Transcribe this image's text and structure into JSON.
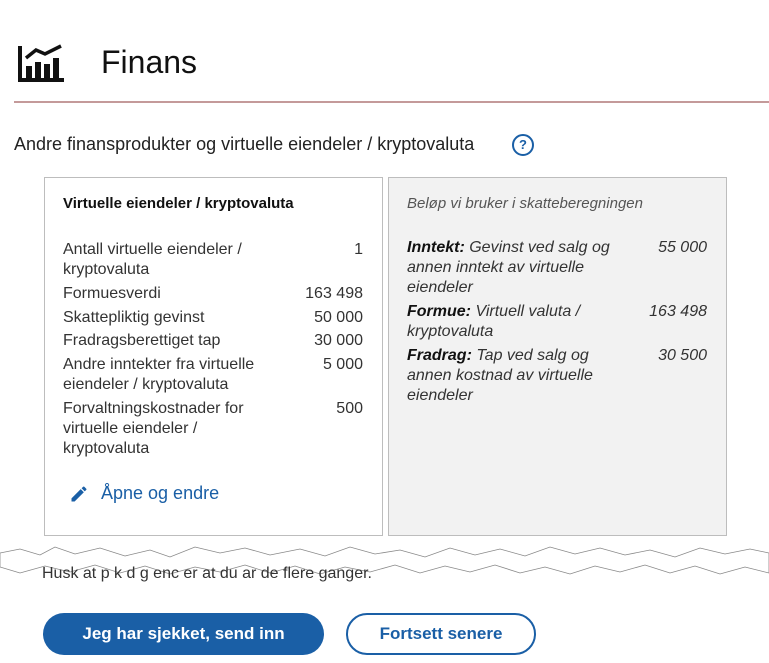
{
  "header": {
    "title": "Finans",
    "icon": "bar-chart-icon"
  },
  "section": {
    "title": "Andre finansprodukter og virtuelle eiendeler / kryptovaluta",
    "help_icon": "question-circle-icon",
    "help_glyph": "?"
  },
  "left_card": {
    "title": "Virtuelle eiendeler / kryptovaluta",
    "rows": [
      {
        "label": "Antall virtuelle eiendeler / kryptovaluta",
        "value": "1"
      },
      {
        "label": "Formuesverdi",
        "value": "163 498"
      },
      {
        "label": "Skattepliktig gevinst",
        "value": "50 000"
      },
      {
        "label": "Fradragsberettiget tap",
        "value": "30 000"
      },
      {
        "label": "Andre inntekter fra virtuelle eiendeler / kryptovaluta",
        "value": "5 000"
      },
      {
        "label": "Forvaltningskostnader for virtuelle eiendeler / kryptovaluta",
        "value": "500"
      }
    ],
    "edit_label": "Åpne og endre"
  },
  "right_card": {
    "heading": "Beløp vi bruker i skatteberegningen",
    "rows": [
      {
        "bold": "Inntekt:",
        "text": "Gevinst ved salg og annen inntekt av virtuelle eiendeler",
        "value": "55 000"
      },
      {
        "bold": "Formue:",
        "text": "Virtuell valuta / kryptovaluta",
        "value": "163 498"
      },
      {
        "bold": "Fradrag:",
        "text": "Tap ved salg og annen kostnad av virtuelle eiendeler",
        "value": "30 500"
      }
    ]
  },
  "partial_text": "Husk at  p k   d g   enc er        at du ar   de   flere ganger.",
  "actions": {
    "primary": "Jeg har sjekket, send inn",
    "secondary": "Fortsett senere"
  },
  "colors": {
    "accent": "#1a5fa6",
    "divider": "#c49a9a"
  }
}
